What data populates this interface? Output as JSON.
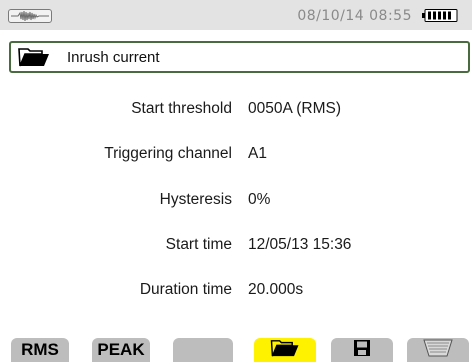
{
  "status": {
    "datetime": "08/10/14 08:55",
    "wave_icon": "waveform-icon",
    "battery_icon": "battery-full-icon"
  },
  "screen": {
    "title": "Inrush current",
    "title_icon": "folder-open-icon"
  },
  "settings": [
    {
      "label": "Start threshold",
      "value": "0050A (RMS)"
    },
    {
      "label": "Triggering channel",
      "value": "A1"
    },
    {
      "label": "Hysteresis",
      "value": "0%"
    },
    {
      "label": "Start time",
      "value": "12/05/13 15:36"
    },
    {
      "label": "Duration time",
      "value": "20.000s"
    }
  ],
  "softkeys": [
    {
      "label": "RMS",
      "icon": null,
      "active": false
    },
    {
      "label": "PEAK",
      "icon": null,
      "active": false
    },
    {
      "label": "",
      "icon": null,
      "active": false
    },
    {
      "label": "",
      "icon": "folder-open-icon",
      "active": true
    },
    {
      "label": "",
      "icon": "save-icon",
      "active": false
    },
    {
      "label": "",
      "icon": "trash-icon",
      "active": false
    }
  ],
  "colors": {
    "status_bg": "#e3e3e3",
    "title_border": "#4a6a3f",
    "softkey_bg": "#bdbdbd",
    "softkey_active": "#fff200"
  }
}
